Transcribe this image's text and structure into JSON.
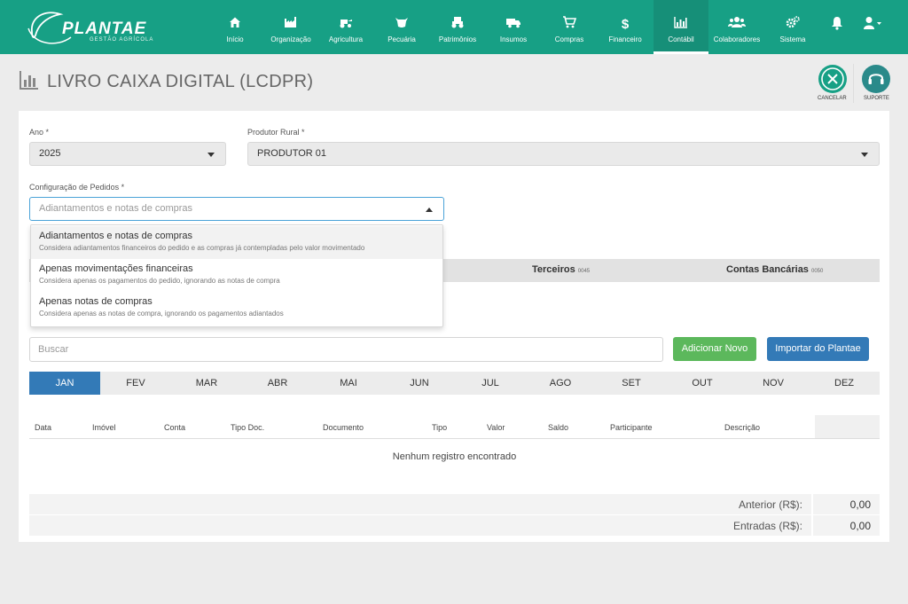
{
  "brand": {
    "name": "PLANTAE",
    "subtitle": "GESTÃO AGRÍCOLA"
  },
  "nav": [
    {
      "label": "Início",
      "icon": "home-icon"
    },
    {
      "label": "Organização",
      "icon": "factory-icon"
    },
    {
      "label": "Agricultura",
      "icon": "tractor-icon"
    },
    {
      "label": "Pecuária",
      "icon": "cow-icon"
    },
    {
      "label": "Patrimônios",
      "icon": "tractor-front-icon"
    },
    {
      "label": "Insumos",
      "icon": "truck-icon"
    },
    {
      "label": "Compras",
      "icon": "cart-icon"
    },
    {
      "label": "Financeiro",
      "icon": "dollar-icon"
    },
    {
      "label": "Contábil",
      "icon": "bar-chart-icon",
      "active": true
    },
    {
      "label": "Colaboradores",
      "icon": "users-icon"
    },
    {
      "label": "Sistema",
      "icon": "gears-icon"
    }
  ],
  "page": {
    "title": "LIVRO CAIXA DIGITAL (LCDPR)"
  },
  "actions": {
    "cancel": "CANCELAR",
    "support": "SUPORTE"
  },
  "form": {
    "ano": {
      "label": "Ano *",
      "value": "2025"
    },
    "produtor": {
      "label": "Produtor Rural *",
      "value": "PRODUTOR 01"
    },
    "config": {
      "label": "Configuração de Pedidos *",
      "placeholder": "Adiantamentos e notas de compras"
    }
  },
  "dropdown": {
    "options": [
      {
        "title": "Adiantamentos e notas de compras",
        "desc": "Considera adiantamentos financeiros do pedido e as compras já contempladas pelo valor movimentado"
      },
      {
        "title": "Apenas movimentações financeiras",
        "desc": "Considera apenas os pagamentos do pedido, ignorando as notas de compra"
      },
      {
        "title": "Apenas notas de compras",
        "desc": "Considera apenas as notas de compra, ignorando os pagamentos adiantados"
      }
    ]
  },
  "tabs": [
    {
      "label": "Terceiros",
      "code": "0045"
    },
    {
      "label": "Contas Bancárias",
      "code": "0050"
    }
  ],
  "search": {
    "placeholder": "Buscar"
  },
  "buttons": {
    "add": "Adicionar Novo",
    "import": "Importar do Plantae"
  },
  "months": [
    "JAN",
    "FEV",
    "MAR",
    "ABR",
    "MAI",
    "JUN",
    "JUL",
    "AGO",
    "SET",
    "OUT",
    "NOV",
    "DEZ"
  ],
  "active_month": "JAN",
  "table": {
    "columns": [
      "Data",
      "Imóvel",
      "Conta",
      "Tipo Doc.",
      "Documento",
      "Tipo",
      "Valor",
      "Saldo",
      "Participante",
      "Descrição"
    ],
    "empty": "Nenhum registro encontrado"
  },
  "summary": [
    {
      "label": "Anterior (R$):",
      "value": "0,00"
    },
    {
      "label": "Entradas (R$):",
      "value": "0,00"
    }
  ],
  "colors": {
    "brand": "#17a085",
    "primary": "#337ab7",
    "success": "#5cb85c"
  }
}
